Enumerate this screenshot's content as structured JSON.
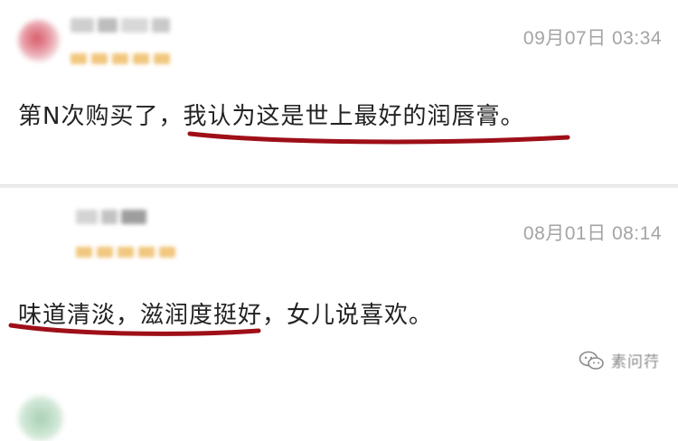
{
  "reviews": [
    {
      "timestamp": "09月07日 03:34",
      "content": "第N次购买了，我认为这是世上最好的润唇膏。"
    },
    {
      "timestamp": "08月01日 08:14",
      "content": "味道清淡，滋润度挺好，女儿说喜欢。"
    }
  ],
  "watermark": {
    "icon": "wechat-icon",
    "text": "素问荇"
  },
  "colors": {
    "underline": "#9e0f18",
    "timestamp": "#a4a4a4",
    "text": "#222222",
    "divider": "#ececec"
  }
}
